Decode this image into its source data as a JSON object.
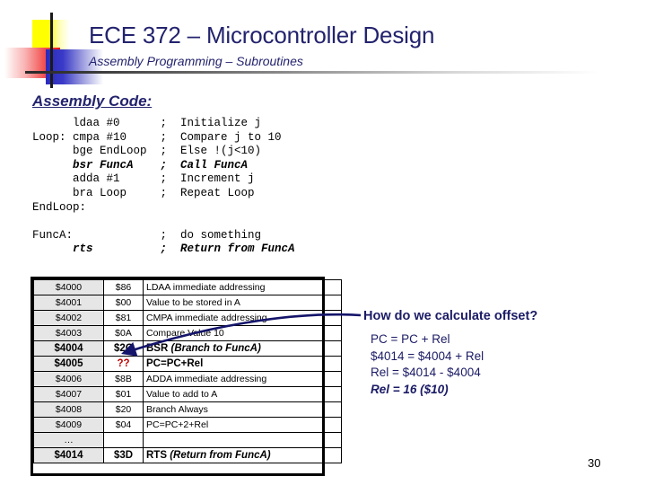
{
  "header": {
    "title": "ECE 372 – Microcontroller Design",
    "subtitle": "Assembly Programming – Subroutines",
    "title_color": "#23236e",
    "decoration": {
      "yellow": "#ffff00",
      "red": "#ee1111",
      "blue": "#2b2bbb",
      "rule": "#2a2a2a"
    }
  },
  "section": {
    "heading": "Assembly Code:"
  },
  "code": {
    "lines": [
      {
        "text": "      ldaa #0      ;  Initialize j",
        "emphasis": false
      },
      {
        "text": "Loop: cmpa #10     ;  Compare j to 10",
        "emphasis": false
      },
      {
        "text": "      bge EndLoop  ;  Else !(j<10)",
        "emphasis": false
      },
      {
        "text": "      bsr FuncA    ;  Call FuncA",
        "emphasis": true
      },
      {
        "text": "      adda #1      ;  Increment j",
        "emphasis": false
      },
      {
        "text": "      bra Loop     ;  Repeat Loop",
        "emphasis": false
      },
      {
        "text": "EndLoop:",
        "emphasis": false
      },
      {
        "text": "",
        "emphasis": false
      },
      {
        "text": "FuncA:             ;  do something",
        "emphasis": false
      },
      {
        "text": "      rts          ;  Return from FuncA",
        "emphasis": true
      }
    ]
  },
  "memory_table": {
    "rows": [
      {
        "address": "$4000",
        "value": "$86",
        "description": "LDAA immediate addressing",
        "bold": false,
        "value_red": false,
        "desc_italic_part": ""
      },
      {
        "address": "$4001",
        "value": "$00",
        "description": "Value to be stored in A",
        "bold": false,
        "value_red": false,
        "desc_italic_part": ""
      },
      {
        "address": "$4002",
        "value": "$81",
        "description": "CMPA immediate addressing",
        "bold": false,
        "value_red": false,
        "desc_italic_part": ""
      },
      {
        "address": "$4003",
        "value": "$0A",
        "description": "Compare Value 10",
        "bold": false,
        "value_red": false,
        "desc_italic_part": ""
      },
      {
        "address": "$4004",
        "value": "$2C",
        "description": "BSR ",
        "bold": true,
        "value_red": false,
        "desc_italic_part": "(Branch to FuncA)"
      },
      {
        "address": "$4005",
        "value": "??",
        "description": "PC=PC+Rel",
        "bold": true,
        "value_red": true,
        "desc_italic_part": ""
      },
      {
        "address": "$4006",
        "value": "$8B",
        "description": "ADDA immediate addressing",
        "bold": false,
        "value_red": false,
        "desc_italic_part": ""
      },
      {
        "address": "$4007",
        "value": "$01",
        "description": "Value to add to A",
        "bold": false,
        "value_red": false,
        "desc_italic_part": ""
      },
      {
        "address": "$4008",
        "value": "$20",
        "description": "Branch Always",
        "bold": false,
        "value_red": false,
        "desc_italic_part": ""
      },
      {
        "address": "$4009",
        "value": "$04",
        "description": "PC=PC+2+Rel",
        "bold": false,
        "value_red": false,
        "desc_italic_part": ""
      },
      {
        "address": "…",
        "value": "",
        "description": "",
        "bold": false,
        "value_red": false,
        "desc_italic_part": ""
      },
      {
        "address": "$4014",
        "value": "$3D",
        "description": "RTS ",
        "bold": true,
        "value_red": false,
        "desc_italic_part": "(Return from FuncA)"
      }
    ]
  },
  "callout": {
    "question": "How do we calculate offset?",
    "lines": [
      {
        "text": "PC = PC + Rel",
        "result": false
      },
      {
        "text": "$4014 = $4004 + Rel",
        "result": false
      },
      {
        "text": "Rel = $4014 - $4004",
        "result": false
      },
      {
        "text": "Rel = 16 ($10)",
        "result": true
      }
    ],
    "color": "#1b1b66",
    "arrow_color": "#14146b"
  },
  "footer": {
    "page_number": "30"
  }
}
